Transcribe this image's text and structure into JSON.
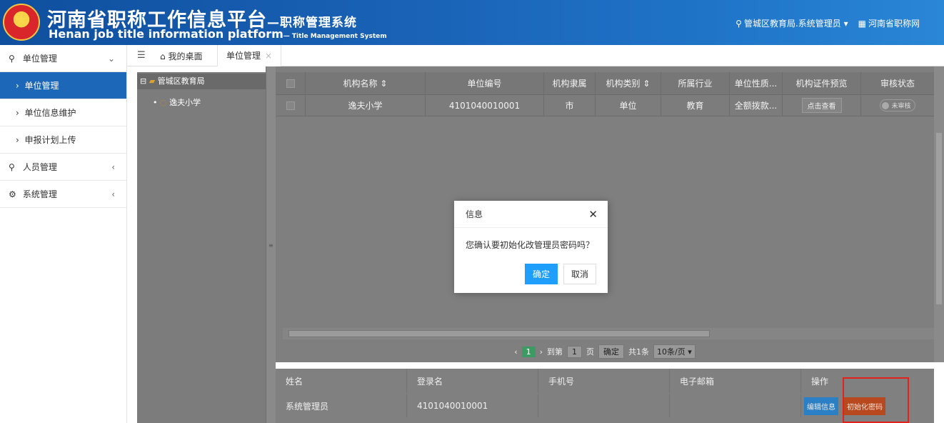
{
  "header": {
    "title_cn": "河南省职称工作信息平台",
    "title_cn_sub": "—职称管理系统",
    "title_en": "Henan job title information platform",
    "title_en_sub": "— Title Management System",
    "user": "管城区教育局.系统管理员",
    "site_link": "河南省职称网"
  },
  "sidebar": {
    "groups": [
      {
        "label": "单位管理",
        "items": [
          "单位管理",
          "单位信息维护",
          "申报计划上传"
        ]
      },
      {
        "label": "人员管理"
      },
      {
        "label": "系统管理"
      }
    ]
  },
  "tabs": {
    "home": "我的桌面",
    "active": "单位管理"
  },
  "tree": {
    "root": "管城区教育局",
    "child": "逸夫小学"
  },
  "grid": {
    "columns": [
      "机构名称",
      "单位编号",
      "机构隶属",
      "机构类别",
      "所属行业",
      "单位性质...",
      "机构证件预览",
      "审核状态"
    ],
    "row": {
      "name": "逸夫小学",
      "code": "4101040010001",
      "affiliation": "市",
      "category": "单位",
      "industry": "教育",
      "nature": "全额拨款...",
      "view_btn": "点击查看",
      "status": "未审核"
    }
  },
  "pager": {
    "page": "1",
    "goto_label": "到第",
    "goto_value": "1",
    "page_unit": "页",
    "confirm": "确定",
    "total": "共1条",
    "per_page": "10条/页"
  },
  "lower": {
    "columns": [
      "姓名",
      "登录名",
      "手机号",
      "电子邮箱",
      "操作"
    ],
    "row": {
      "name": "系统管理员",
      "login": "4101040010001",
      "phone": "",
      "email": "",
      "edit_btn": "编辑信息",
      "init_btn": "初始化密码"
    }
  },
  "dialog": {
    "title": "信息",
    "message": "您确认要初始化改管理员密码吗？",
    "ok": "确定",
    "cancel": "取消"
  },
  "colors": {
    "primary": "#1d67b9",
    "dialog_ok": "#1e9fff",
    "init_btn": "#b8491e",
    "highlight": "#e0231d"
  }
}
